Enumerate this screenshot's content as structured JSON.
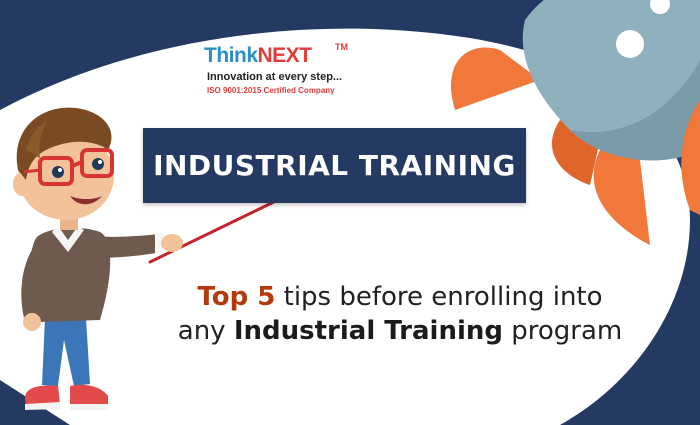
{
  "logo": {
    "brand_part1": "Think",
    "brand_part2": "NEXT",
    "trademark": "TM",
    "tagline": "Innovation at every step...",
    "certification": "ISO 9001:2015 Certified Company"
  },
  "banner": {
    "title": "INDUSTRIAL TRAINING"
  },
  "headline": {
    "line1_highlight": "Top 5",
    "line1_rest": " tips before enrolling into",
    "line2_prefix": "any ",
    "line2_bold": "Industrial Training",
    "line2_suffix": " program"
  },
  "colors": {
    "navy": "#243a63",
    "rocket_body": "#8fb0bd",
    "rocket_fins": "#f0783a",
    "highlight_red": "#b23a0d",
    "logo_blue": "#2a8fc4",
    "logo_red": "#e33a3a"
  }
}
